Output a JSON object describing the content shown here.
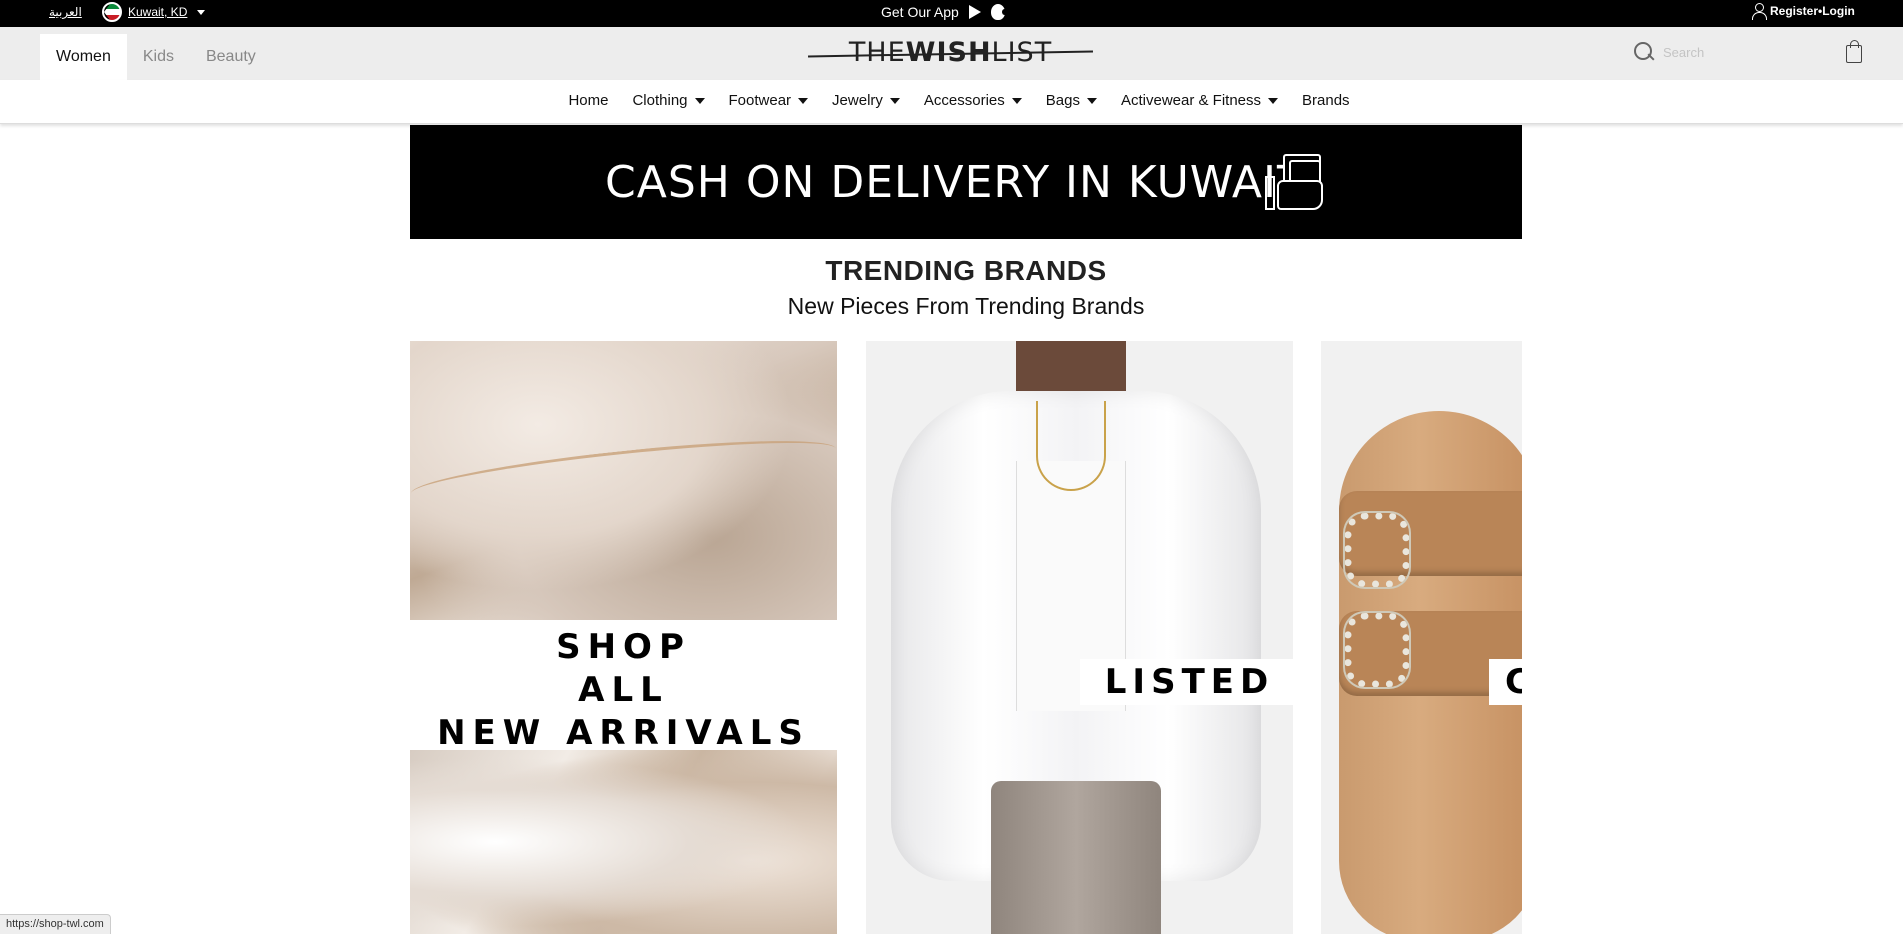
{
  "topbar": {
    "arabic_link": "العربية",
    "country": "Kuwait, KD",
    "get_app": "Get Our App",
    "account": "Register•Login"
  },
  "header": {
    "tabs": [
      {
        "label": "Women",
        "active": true
      },
      {
        "label": "Kids",
        "active": false
      },
      {
        "label": "Beauty",
        "active": false
      }
    ],
    "logo": {
      "part1": "THE",
      "part2": "WISH",
      "part3": "LIST"
    },
    "search": {
      "placeholder": "Search",
      "value": ""
    }
  },
  "nav": {
    "items": [
      {
        "label": "Home",
        "has_dropdown": false
      },
      {
        "label": "Clothing",
        "has_dropdown": true
      },
      {
        "label": "Footwear",
        "has_dropdown": true
      },
      {
        "label": "Jewelry",
        "has_dropdown": true
      },
      {
        "label": "Accessories",
        "has_dropdown": true
      },
      {
        "label": "Bags",
        "has_dropdown": true
      },
      {
        "label": "Activewear & Fitness",
        "has_dropdown": true
      },
      {
        "label": "Brands",
        "has_dropdown": false
      }
    ]
  },
  "banner": {
    "text": "CASH ON DELIVERY IN KUWAIT"
  },
  "trending": {
    "title": "TRENDING BRANDS",
    "subtitle": "New Pieces From Trending Brands",
    "cards": [
      {
        "line1": "SHOP",
        "line2": "ALL",
        "line3": "NEW ARRIVALS"
      },
      {
        "label": "LISTED"
      },
      {
        "label": "C"
      }
    ]
  },
  "statusbar": {
    "url": "https://shop-twl.com"
  },
  "colors": {
    "topbar": "#000000",
    "header_bg": "#ededed",
    "card_bg": "#f1f1f1"
  }
}
